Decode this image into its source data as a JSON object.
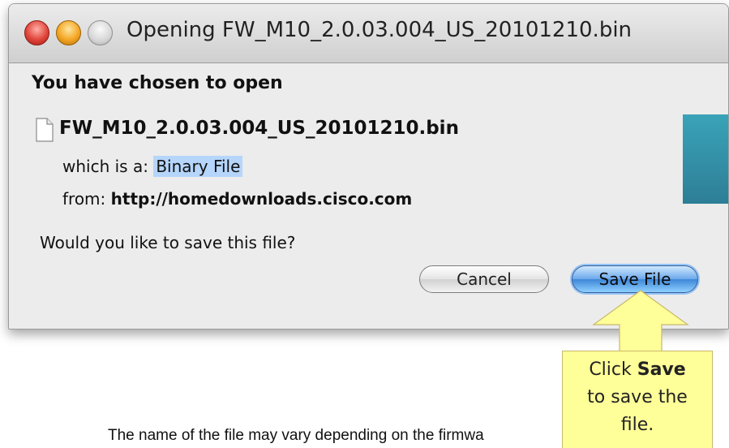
{
  "window": {
    "title": "Opening FW_M10_2.0.03.004_US_20101210.bin"
  },
  "dialog": {
    "heading": "You have chosen to open",
    "filename": "FW_M10_2.0.03.004_US_20101210.bin",
    "type_label": "which is a:",
    "type_value": "Binary File",
    "from_label": "from:",
    "from_value": "http://homedownloads.cisco.com",
    "question": "Would you like to save this file?",
    "cancel_label": "Cancel",
    "save_label": "Save File"
  },
  "callout": {
    "line1_prefix": "Click ",
    "line1_bold": "Save",
    "line2": "to save the",
    "line3": "file."
  },
  "footnote": "The name of the file may vary depending on the firmwa",
  "colors": {
    "highlight": "#b5d5fb",
    "callout_bg": "#ffff99",
    "save_button": "#3d86d8"
  }
}
